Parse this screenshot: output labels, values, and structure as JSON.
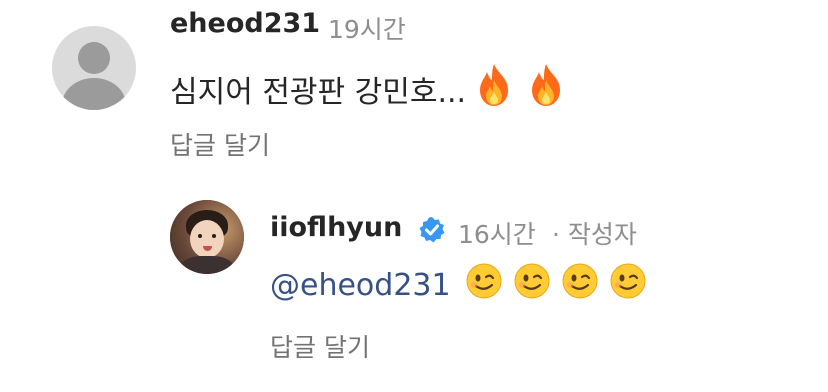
{
  "comment": {
    "username": "eheod231",
    "time": "19시간",
    "text": "심지어 전광판 강민호...",
    "emojis": [
      "fire",
      "fire"
    ],
    "reply_label": "답글 달기"
  },
  "reply": {
    "username": "iioflhyun",
    "time": "16시간",
    "author_badge": "· 작성자",
    "mention": "@eheod231",
    "emojis": [
      "winking-face",
      "winking-face",
      "winking-face",
      "winking-face"
    ],
    "reply_label": "답글 달기",
    "verified_color": "#3897f0"
  }
}
